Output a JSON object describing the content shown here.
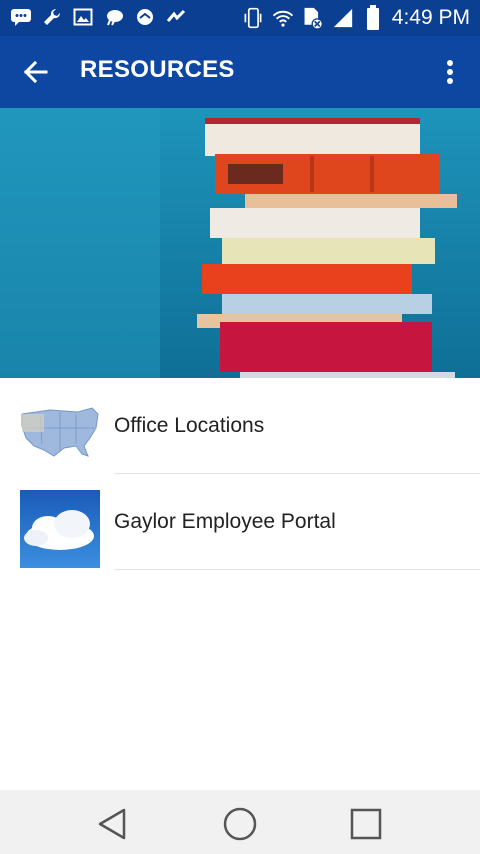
{
  "status_bar": {
    "time": "4:49 PM",
    "icons": [
      "message-icon",
      "wrench-icon",
      "image-icon",
      "weather-icon",
      "app-icon",
      "signal-app-icon",
      "vibrate-icon",
      "wifi-icon",
      "sim-icon",
      "cell-signal-icon",
      "battery-icon"
    ]
  },
  "app_bar": {
    "title": "RESOURCES",
    "back_icon": "arrow-back-icon",
    "menu_icon": "more-vert-icon"
  },
  "hero": {
    "image": "stack-of-books-image"
  },
  "resources": [
    {
      "label": "Office Locations",
      "thumbnail": "us-map-thumbnail"
    },
    {
      "label": "Gaylor Employee Portal",
      "thumbnail": "cloud-sky-thumbnail"
    }
  ],
  "nav_bar": {
    "buttons": [
      "back-triangle-icon",
      "home-circle-icon",
      "recents-square-icon"
    ]
  },
  "colors": {
    "status_bar": "#0a3f92",
    "app_bar": "#0d47a1",
    "hero_background": "#1d8fb5"
  }
}
